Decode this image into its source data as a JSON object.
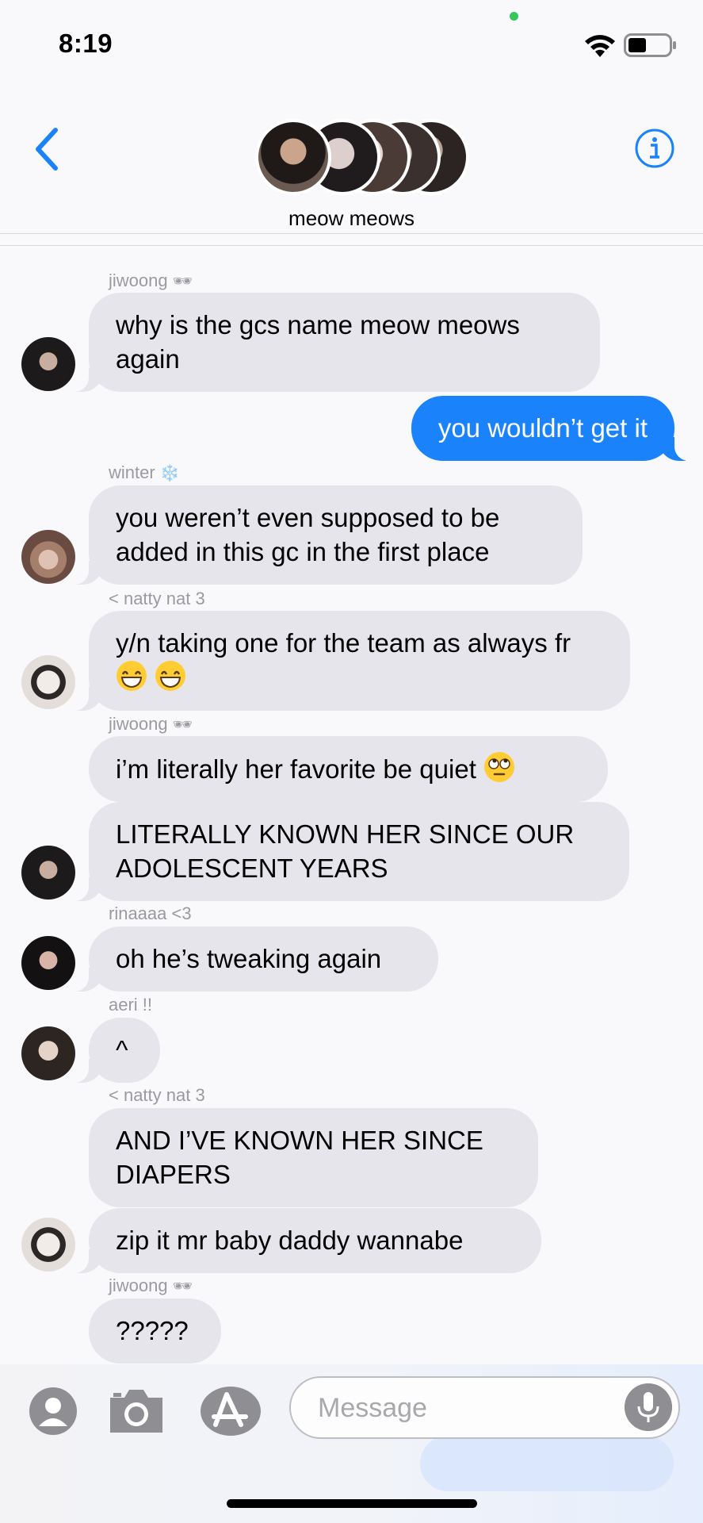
{
  "status_bar": {
    "time": "8:19"
  },
  "header": {
    "group_name": "meow meows"
  },
  "messages": [
    {
      "sender": "jiwoong",
      "sender_glyph": "🕶",
      "text": "why is the gcs name meow meows again"
    },
    {
      "text": "you wouldn’t get it",
      "direction": "outgoing"
    },
    {
      "sender": "winter",
      "sender_glyph": "❄️",
      "text": "you weren’t even supposed to be added in this gc in the first place"
    },
    {
      "sender": "< natty nat 3",
      "text": "y/n taking one for the team as always fr"
    },
    {
      "sender": "jiwoong",
      "sender_glyph": "🕶",
      "text": "i’m literally her favorite be quiet"
    },
    {
      "text": "LITERALLY KNOWN HER SINCE OUR ADOLESCENT YEARS"
    },
    {
      "sender": "rinaaaa <3",
      "text": "oh he’s tweaking again"
    },
    {
      "sender": "aeri !!",
      "text": "^"
    },
    {
      "sender": "< natty nat 3",
      "text": "AND I’VE KNOWN HER SINCE DIAPERS"
    },
    {
      "text": "zip it mr baby daddy wannabe"
    },
    {
      "sender": "jiwoong",
      "sender_glyph": "🕶",
      "text": "?????"
    }
  ],
  "input_bar": {
    "placeholder": "Message"
  },
  "icons": [
    "back-chevron-icon",
    "info-icon",
    "wifi-icon",
    "battery-icon",
    "contact-icon",
    "camera-icon",
    "app-store-icon",
    "mic-icon",
    "grinning-emoji",
    "eye-roll-emoji"
  ],
  "colors": {
    "outgoing_bubble": "#1a82fb",
    "incoming_bubble": "#e7e5ec",
    "accent": "#1a82fb"
  }
}
